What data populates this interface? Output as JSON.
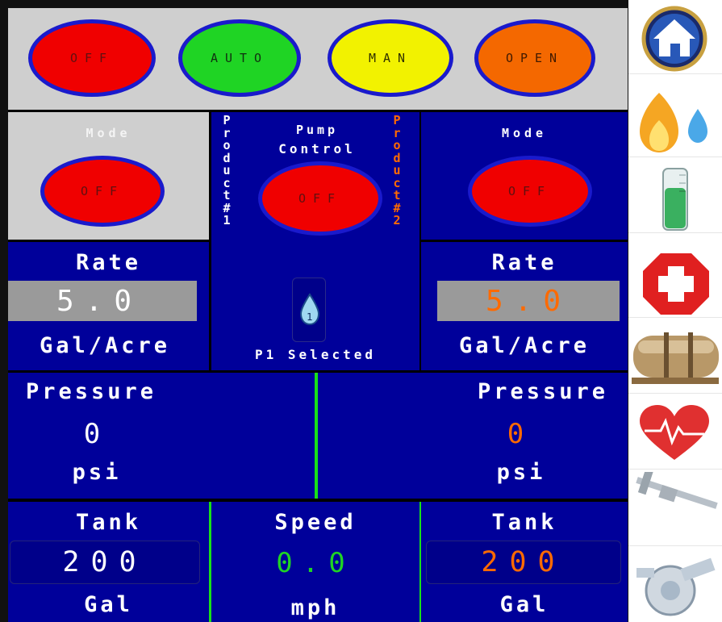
{
  "top_buttons": {
    "off": "OFF",
    "auto": "AUTO",
    "man": "MAN",
    "open": "OPEN"
  },
  "left_mode": {
    "label": "Mode",
    "button": "OFF"
  },
  "right_mode": {
    "label": "Mode",
    "button": "OFF"
  },
  "pump": {
    "title_line1": "Pump",
    "title_line2": "Control",
    "button": "OFF",
    "product1_vertical": "Product#1",
    "product2_vertical": "Product#2",
    "selected_icon_number": "1",
    "selected_text": "P1 Selected"
  },
  "left_rate": {
    "label": "Rate",
    "value": "5.0",
    "unit": "Gal/Acre"
  },
  "right_rate": {
    "label": "Rate",
    "value": "5.0",
    "unit": "Gal/Acre"
  },
  "left_pressure": {
    "label": "Pressure",
    "value": "0",
    "unit": "psi"
  },
  "right_pressure": {
    "label": "Pressure",
    "value": "0",
    "unit": "psi"
  },
  "left_tank": {
    "label": "Tank",
    "value": "200",
    "unit": "Gal"
  },
  "speed": {
    "label": "Speed",
    "value": "0.0",
    "unit": "mph"
  },
  "right_tank": {
    "label": "Tank",
    "value": "200",
    "unit": "Gal"
  },
  "colors": {
    "panel_blue": "#00009a",
    "product2_orange": "#ff6a00",
    "speed_green": "#1fd424",
    "divider_green": "#19e019"
  },
  "side_icons": [
    "home-icon",
    "fluid-drops-icon",
    "test-tube-icon",
    "red-cross-icon",
    "tank-icon",
    "heartbeat-icon",
    "caliper-icon",
    "flowmeter-icon"
  ]
}
